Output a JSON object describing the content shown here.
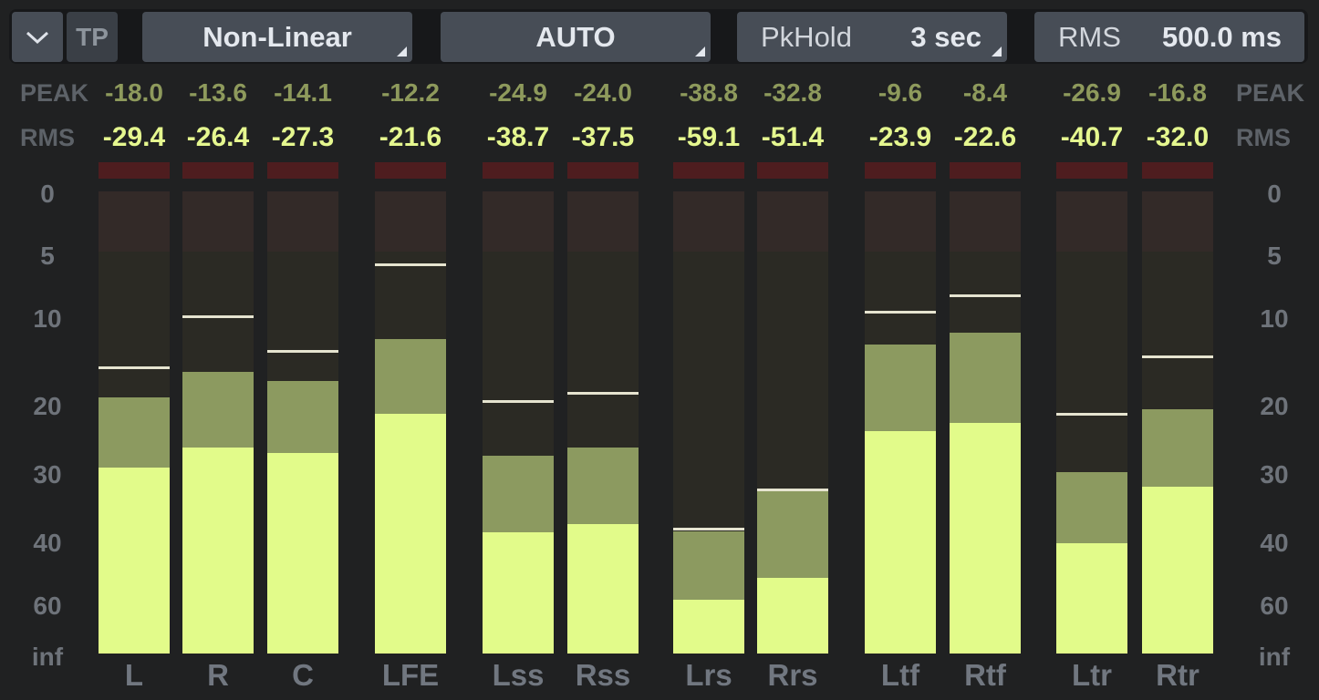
{
  "toolbar": {
    "collapse_icon": "chevron-down-icon",
    "tp_label": "TP",
    "scale_mode": "Non-Linear",
    "range_mode": "AUTO",
    "pkhold_label": "PkHold",
    "pkhold_value": "3 sec",
    "rms_label": "RMS",
    "rms_value": "500.0 ms"
  },
  "labels": {
    "peak": "PEAK",
    "rms": "RMS"
  },
  "scale_ticks": [
    "0",
    "5",
    "10",
    "20",
    "30",
    "40",
    "60",
    "inf"
  ],
  "channels": [
    {
      "name": "L",
      "peak": "-18.0",
      "rms": "-29.4",
      "peak_level": 0.555,
      "rms_level": 0.403,
      "hold_level": 0.62
    },
    {
      "name": "R",
      "peak": "-13.6",
      "rms": "-26.4",
      "peak_level": 0.61,
      "rms_level": 0.446,
      "hold_level": 0.73
    },
    {
      "name": "C",
      "peak": "-14.1",
      "rms": "-27.3",
      "peak_level": 0.59,
      "rms_level": 0.433,
      "hold_level": 0.655
    },
    {
      "name": "LFE",
      "peak": "-12.2",
      "rms": "-21.6",
      "peak_level": 0.68,
      "rms_level": 0.518,
      "hold_level": 0.842
    },
    {
      "name": "Lss",
      "peak": "-24.9",
      "rms": "-38.7",
      "peak_level": 0.428,
      "rms_level": 0.262,
      "hold_level": 0.547
    },
    {
      "name": "Rss",
      "peak": "-24.0",
      "rms": "-37.5",
      "peak_level": 0.446,
      "rms_level": 0.28,
      "hold_level": 0.565
    },
    {
      "name": "Lrs",
      "peak": "-38.8",
      "rms": "-59.1",
      "peak_level": 0.264,
      "rms_level": 0.116,
      "hold_level": 0.27
    },
    {
      "name": "Rrs",
      "peak": "-32.8",
      "rms": "-51.4",
      "peak_level": 0.353,
      "rms_level": 0.164,
      "hold_level": 0.355
    },
    {
      "name": "Ltf",
      "peak": "-9.6",
      "rms": "-23.9",
      "peak_level": 0.669,
      "rms_level": 0.482,
      "hold_level": 0.74
    },
    {
      "name": "Rtf",
      "peak": "-8.4",
      "rms": "-22.6",
      "peak_level": 0.694,
      "rms_level": 0.5,
      "hold_level": 0.775
    },
    {
      "name": "Ltr",
      "peak": "-26.9",
      "rms": "-40.7",
      "peak_level": 0.392,
      "rms_level": 0.238,
      "hold_level": 0.518
    },
    {
      "name": "Rtr",
      "peak": "-16.8",
      "rms": "-32.0",
      "peak_level": 0.529,
      "rms_level": 0.36,
      "hold_level": 0.643
    }
  ]
}
